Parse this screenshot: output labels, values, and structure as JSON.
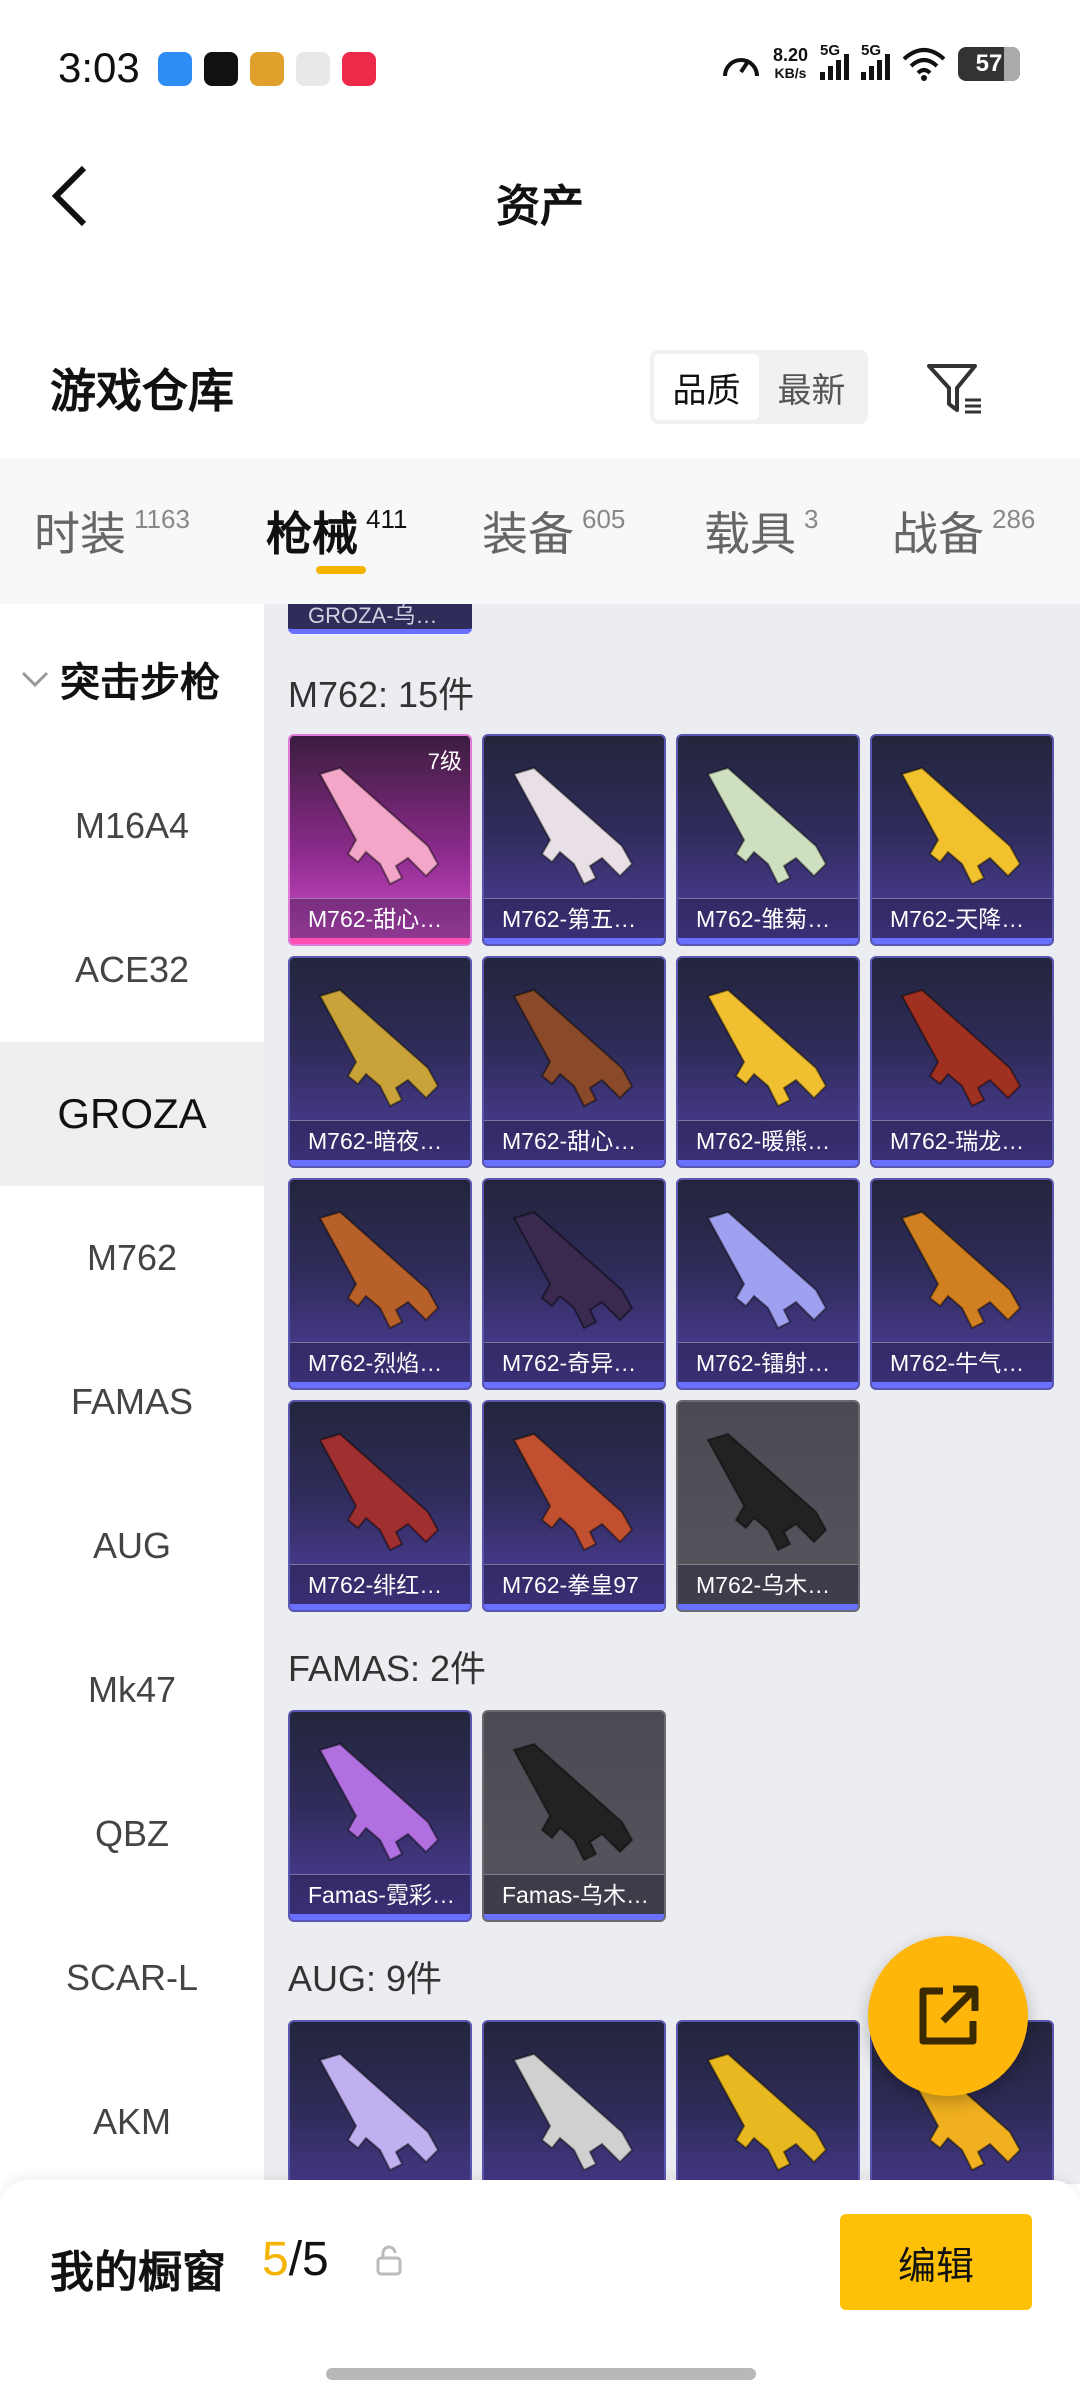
{
  "status_bar": {
    "time": "3:03",
    "net_speed": "8.20",
    "net_unit": "KB/s",
    "signal1": "5G",
    "signal2": "5G",
    "battery": "57"
  },
  "header": {
    "title": "资产"
  },
  "warehouse": {
    "title": "游戏仓库",
    "sort_options": [
      "品质",
      "最新"
    ],
    "active_sort": "品质"
  },
  "tabs": [
    {
      "label": "时装",
      "count": "1163"
    },
    {
      "label": "枪械",
      "count": "411"
    },
    {
      "label": "装备",
      "count": "605"
    },
    {
      "label": "载具",
      "count": "3"
    },
    {
      "label": "战备",
      "count": "286"
    }
  ],
  "sidebar": {
    "group": "突击步枪",
    "items": [
      "M16A4",
      "ACE32",
      "GROZA",
      "M762",
      "FAMAS",
      "AUG",
      "Mk47",
      "QBZ",
      "SCAR-L",
      "AKM"
    ],
    "active": "GROZA"
  },
  "content": {
    "top_stub": "GROZA-乌…",
    "sections": [
      {
        "heading": "M762: 15件",
        "items": [
          {
            "name": "M762-甜心…",
            "level": "7级"
          },
          {
            "name": "M762-第五…"
          },
          {
            "name": "M762-雏菊…"
          },
          {
            "name": "M762-天降…"
          },
          {
            "name": "M762-暗夜…"
          },
          {
            "name": "M762-甜心…"
          },
          {
            "name": "M762-暖熊…"
          },
          {
            "name": "M762-瑞龙…"
          },
          {
            "name": "M762-烈焰…"
          },
          {
            "name": "M762-奇异…"
          },
          {
            "name": "M762-镭射…"
          },
          {
            "name": "M762-牛气…"
          },
          {
            "name": "M762-绯红…"
          },
          {
            "name": "M762-拳皇97"
          },
          {
            "name": "M762-乌木…"
          }
        ]
      },
      {
        "heading": "FAMAS: 2件",
        "items": [
          {
            "name": "Famas-霓彩…"
          },
          {
            "name": "Famas-乌木…"
          }
        ]
      },
      {
        "heading": "AUG: 9件",
        "items": [
          {
            "name": ""
          },
          {
            "name": ""
          },
          {
            "name": ""
          },
          {
            "name": ""
          }
        ]
      }
    ]
  },
  "bottom_bar": {
    "label": "我的橱窗",
    "current": "5",
    "total": "/5",
    "edit_label": "编辑"
  },
  "colors": {
    "accent": "#f5b400",
    "card_purple": "#5240a2",
    "card_pink": "#d54fd0",
    "card_gray": "#56575e"
  }
}
